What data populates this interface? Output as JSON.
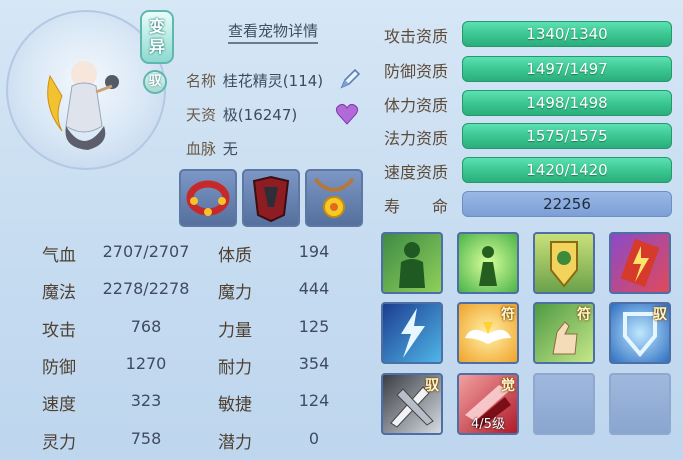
{
  "header": {
    "detail_link": "查看宠物详情"
  },
  "badges": {
    "change": "变异",
    "tame": "驭"
  },
  "info": {
    "name_label": "名称",
    "name_value": "桂花精灵(114)",
    "talent_label": "天资",
    "talent_value": "极(16247)",
    "blood_label": "血脉",
    "blood_value": "无"
  },
  "equipment": [
    {
      "name": "red-collar-icon"
    },
    {
      "name": "crimson-armor-icon"
    },
    {
      "name": "sun-necklace-icon"
    }
  ],
  "stats": [
    {
      "label": "气血",
      "value": "2707/2707",
      "label2": "体质",
      "value2": "194"
    },
    {
      "label": "魔法",
      "value": "2278/2278",
      "label2": "魔力",
      "value2": "444"
    },
    {
      "label": "攻击",
      "value": "768",
      "label2": "力量",
      "value2": "125"
    },
    {
      "label": "防御",
      "value": "1270",
      "label2": "耐力",
      "value2": "354"
    },
    {
      "label": "速度",
      "value": "323",
      "label2": "敏捷",
      "value2": "124"
    },
    {
      "label": "灵力",
      "value": "758",
      "label2": "潜力",
      "value2": "0"
    }
  ],
  "aptitudes": [
    {
      "label": "攻击资质",
      "value": "1340/1340",
      "fill": 1.0
    },
    {
      "label": "防御资质",
      "value": "1497/1497",
      "fill": 1.0
    },
    {
      "label": "体力资质",
      "value": "1498/1498",
      "fill": 1.0
    },
    {
      "label": "法力资质",
      "value": "1575/1575",
      "fill": 1.0
    },
    {
      "label": "速度资质",
      "value": "1420/1420",
      "fill": 1.0
    },
    {
      "label": "寿　　命",
      "value": "22256"
    }
  ],
  "skills": [
    {
      "icon": "green-body-icon",
      "tag": "",
      "level": ""
    },
    {
      "icon": "glowing-figure-icon",
      "tag": "",
      "level": ""
    },
    {
      "icon": "shield-emblem-icon",
      "tag": "",
      "level": ""
    },
    {
      "icon": "lightning-scroll-icon",
      "tag": "",
      "level": ""
    },
    {
      "icon": "blue-lightning-icon",
      "tag": "",
      "level": ""
    },
    {
      "icon": "angel-wings-icon",
      "tag": "符",
      "level": ""
    },
    {
      "icon": "hand-gesture-icon",
      "tag": "符",
      "level": ""
    },
    {
      "icon": "blue-shield-icon",
      "tag": "驭",
      "level": ""
    },
    {
      "icon": "silver-blades-icon",
      "tag": "驭",
      "level": ""
    },
    {
      "icon": "red-dash-icon",
      "tag": "觉",
      "level": "4/5级"
    },
    {
      "icon": "empty-slot",
      "tag": "",
      "level": ""
    },
    {
      "icon": "empty-slot",
      "tag": "",
      "level": ""
    }
  ]
}
